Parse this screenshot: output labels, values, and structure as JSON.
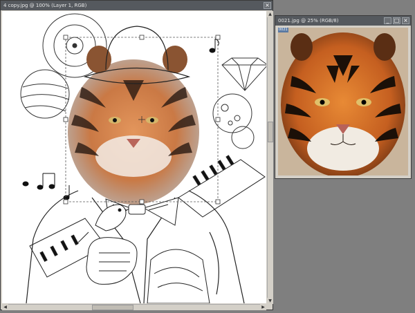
{
  "main_window": {
    "title": "4 copy.jpg @ 100% (Layer 1, RGB)"
  },
  "secondary_window": {
    "title": "0021.jpg @ 25% (RGB/8)",
    "tab_label": "0021"
  },
  "window_controls": {
    "minimize": "_",
    "maximize": "□",
    "close": "×"
  },
  "scroll_glyphs": {
    "up": "▲",
    "down": "▼",
    "left": "◀",
    "right": "▶"
  },
  "colors": {
    "workspace": "#7f7f7f",
    "titlebar": "#55595e",
    "tiger_orange": "#c96a2a",
    "tiger_dark": "#2a1a12"
  }
}
